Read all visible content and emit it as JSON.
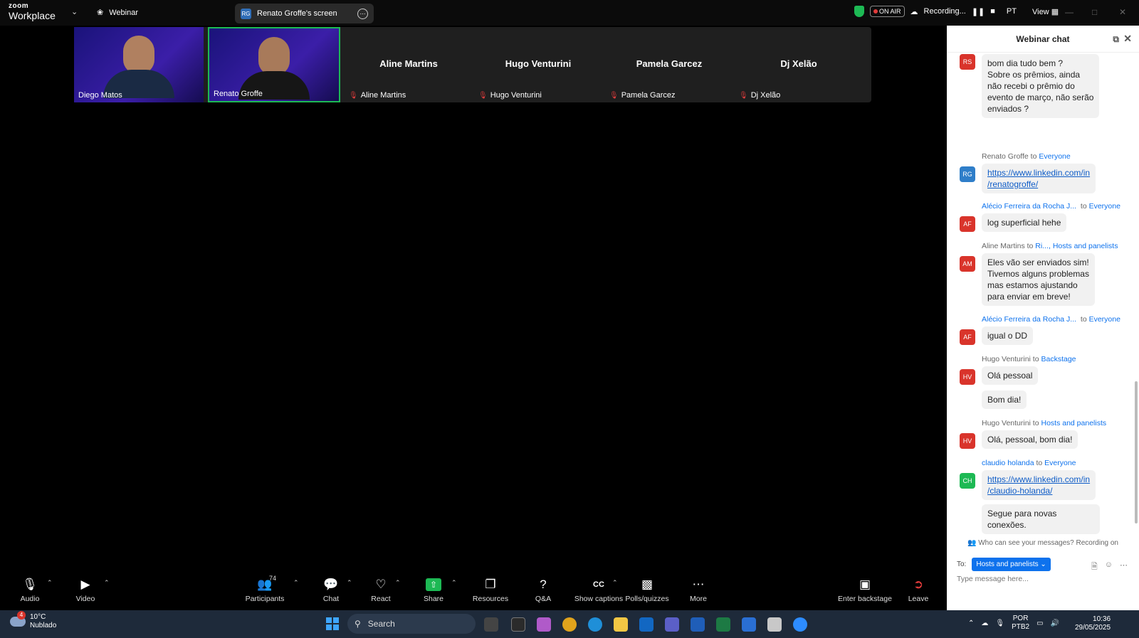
{
  "titlebar": {
    "logo_line1": "zoom",
    "logo_line2": "Workplace",
    "webinar_label": "Webinar",
    "screen_share_avatar": "RG",
    "screen_share_label": "Renato Groffe's screen",
    "on_air": "ON AIR",
    "recording": "Recording...",
    "lang": "PT",
    "view": "View"
  },
  "participants_strip": [
    {
      "name": "Diego Matos",
      "video": true,
      "muted": false
    },
    {
      "name": "Renato Groffe",
      "video": true,
      "muted": false,
      "active": true
    },
    {
      "name": "Aline Martins",
      "video": false,
      "muted": true
    },
    {
      "name": "Hugo Venturini",
      "video": false,
      "muted": true
    },
    {
      "name": "Pamela Garcez",
      "video": false,
      "muted": true
    },
    {
      "name": "Dj Xelão",
      "video": false,
      "muted": true
    }
  ],
  "chat": {
    "title": "Webinar chat",
    "messages": [
      {
        "avatar": "RS",
        "avatar_color": "#d9342b",
        "sender": "",
        "to": "",
        "text": "bom dia tudo bem ?\nSobre os prêmios, ainda\nnão recebi o prêmio do\nevento de março, não serão\nenviados ?"
      },
      {
        "avatar": "RG",
        "avatar_color": "#2f7ec9",
        "sender": "Renato Groffe",
        "to": "Everyone",
        "link": "https://www.linkedin.com/in\n/renatogroffe/"
      },
      {
        "avatar": "AF",
        "avatar_color": "#d9342b",
        "sender": "Alécio Ferreira da Rocha J...",
        "to": "Everyone",
        "text": "log superficial hehe"
      },
      {
        "avatar": "AM",
        "avatar_color": "#d9342b",
        "sender": "Aline Martins",
        "to_prefix": "Ri...,",
        "to": "Hosts and panelists",
        "text": "Eles vão ser enviados sim!\nTivemos alguns problemas\nmas estamos ajustando\npara enviar em breve!"
      },
      {
        "avatar": "AF",
        "avatar_color": "#d9342b",
        "sender": "Alécio Ferreira da Rocha J...",
        "to": "Everyone",
        "text": "igual o DD"
      },
      {
        "avatar": "HV",
        "avatar_color": "#d9342b",
        "sender": "Hugo Venturini",
        "to": "Backstage",
        "text": "Olá pessoal",
        "text2": "Bom dia!"
      },
      {
        "avatar": "HV",
        "avatar_color": "#d9342b",
        "sender": "Hugo Venturini",
        "to": "Hosts and panelists",
        "text": "Olá, pessoal, bom dia!"
      },
      {
        "avatar": "CH",
        "avatar_color": "#1db954",
        "sender": "claudio holanda",
        "to": "Everyone",
        "link": "https://www.linkedin.com/in\n/claudio-holanda/",
        "text2": "Segue para novas\nconexões."
      }
    ],
    "who_can_see": "Who can see your messages? Recording on",
    "to_label": "To:",
    "to_value": "Hosts and panelists",
    "input_placeholder": "Type message here..."
  },
  "toolbar": {
    "audio": "Audio",
    "video": "Video",
    "participants": "Participants",
    "participants_count": "74",
    "chat": "Chat",
    "react": "React",
    "share": "Share",
    "resources": "Resources",
    "qa": "Q&A",
    "show_captions": "Show captions",
    "polls": "Polls/quizzes",
    "more": "More",
    "enter_backstage": "Enter backstage",
    "leave": "Leave"
  },
  "taskbar": {
    "weather_temp": "10°C",
    "weather_desc": "Nublado",
    "weather_badge": "4",
    "search": "Search",
    "lang1": "POR",
    "lang2": "PTB2",
    "time": "10:36",
    "date": "29/05/2025"
  }
}
